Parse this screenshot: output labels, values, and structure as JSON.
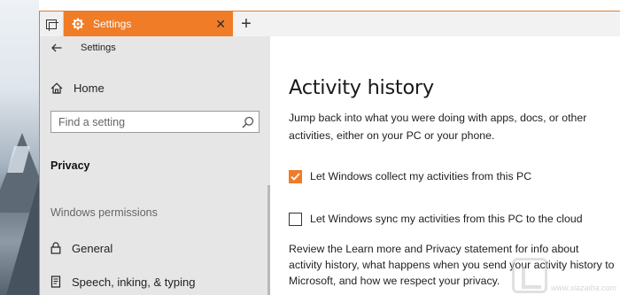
{
  "window": {
    "tab_title": "Settings",
    "accent_color": "#f07c27"
  },
  "icons": {
    "tabs": "tabs-overview-icon",
    "tab_gear": "gear-icon",
    "tab_close": "close-icon",
    "new_tab": "plus-icon",
    "back": "back-arrow-icon",
    "home": "home-icon",
    "search": "search-icon",
    "general": "lock-icon",
    "speech": "document-icon"
  },
  "nav": {
    "header_title": "Settings",
    "home_label": "Home",
    "search_placeholder": "Find a setting",
    "section_title": "Privacy",
    "group_heading": "Windows permissions",
    "items": [
      {
        "label": "General"
      },
      {
        "label": "Speech, inking, & typing"
      }
    ]
  },
  "content": {
    "title": "Activity history",
    "description": "Jump back into what you were doing with apps, docs, or other activities, either on your PC or your phone.",
    "options": [
      {
        "label": "Let Windows collect my activities from this PC",
        "checked": true
      },
      {
        "label": "Let Windows sync my activities from this PC to the cloud",
        "checked": false
      }
    ],
    "review_text": "Review the Learn more and Privacy statement for info about activity history, what happens when you send your activity history to Microsoft, and how we respect your privacy."
  },
  "watermark": {
    "text": "www.xiazaiba.com"
  }
}
